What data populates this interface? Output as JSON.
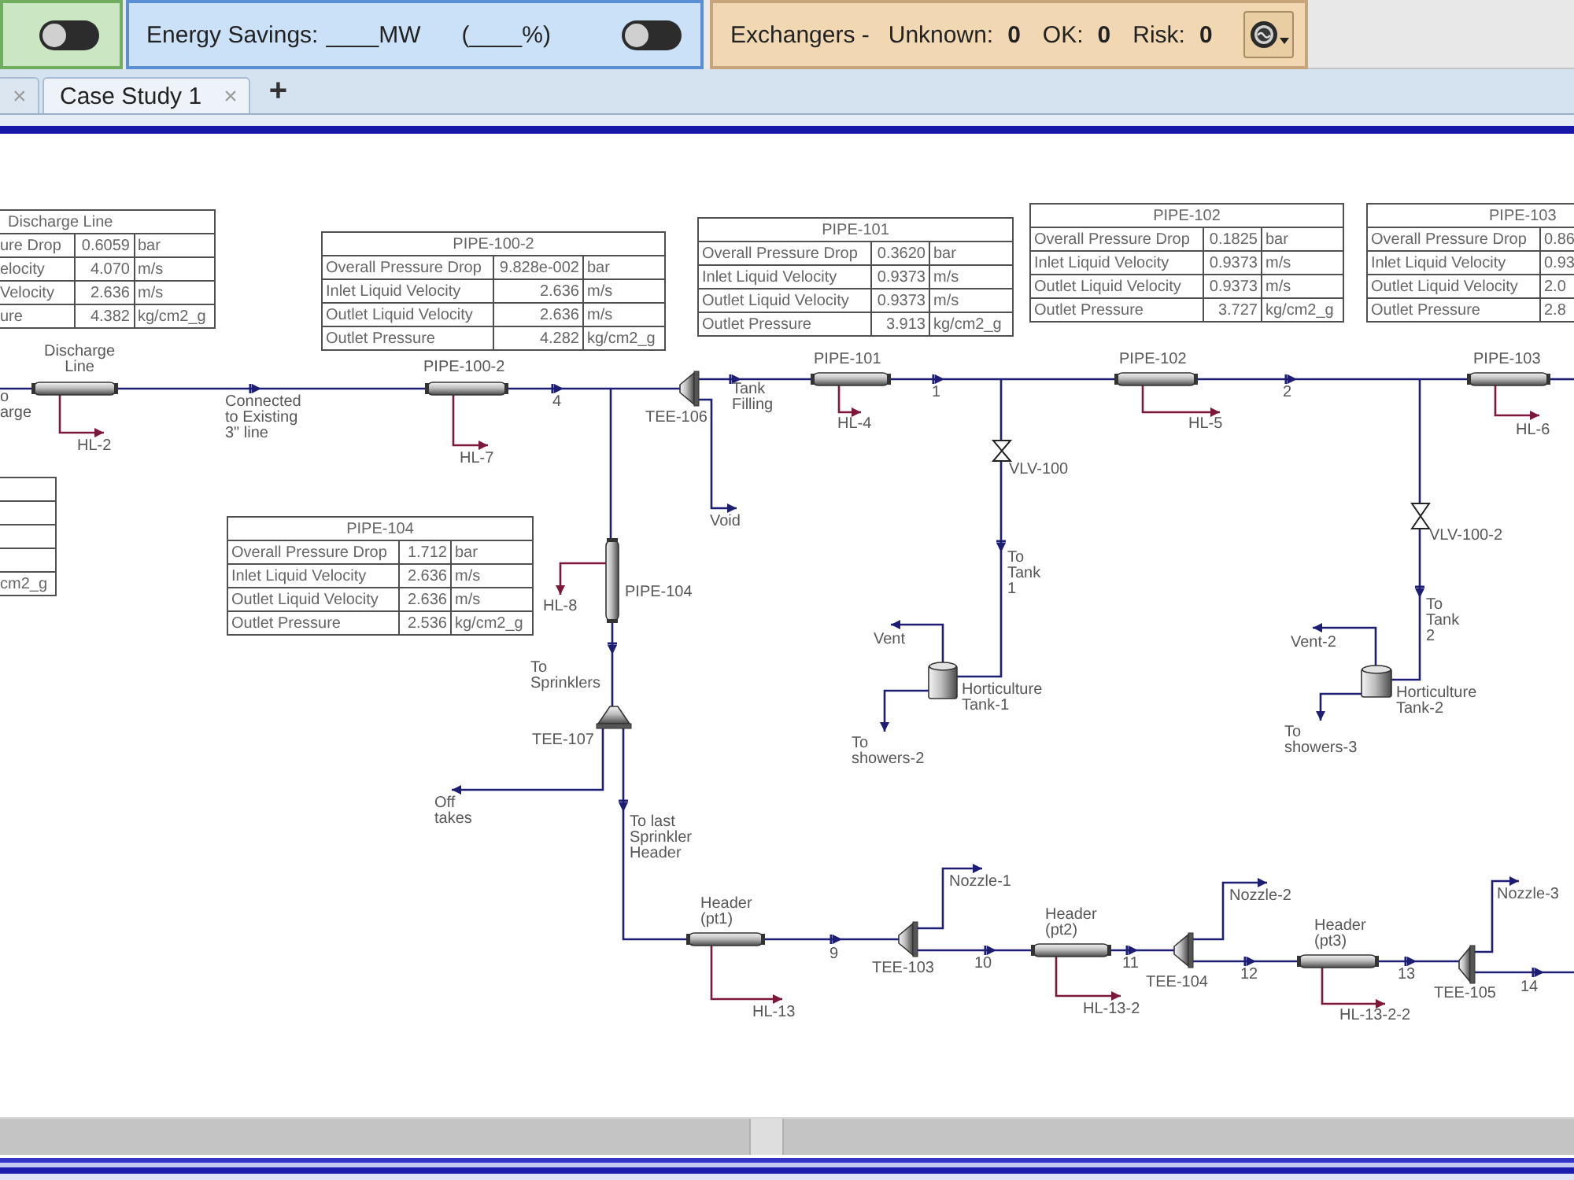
{
  "toolbar": {
    "utilities_toggle": {
      "on": false
    },
    "energy_savings": {
      "label": "Energy Savings:",
      "mw": "____MW",
      "percent": "(____%)",
      "toggle": {
        "on": false
      }
    },
    "exchangers": {
      "title": "Exchangers -",
      "counts": [
        {
          "label": "Unknown:",
          "value": "0"
        },
        {
          "label": "OK:",
          "value": "0"
        },
        {
          "label": "Risk:",
          "value": "0"
        }
      ]
    }
  },
  "tabs": [
    {
      "close": "×",
      "selected": false
    },
    {
      "label": "Case Study 1",
      "close": "×",
      "selected": true
    }
  ],
  "add_tab": "+",
  "flowsheet": {
    "tables": [
      {
        "title": "Discharge Line",
        "rows": [
          {
            "label": "ure Drop",
            "value": "0.6059",
            "unit": "bar"
          },
          {
            "label": "elocity",
            "value": "4.070",
            "unit": "m/s"
          },
          {
            "label": "Velocity",
            "value": "2.636",
            "unit": "m/s"
          },
          {
            "label": "ure",
            "value": "4.382",
            "unit": "kg/cm2_g"
          }
        ]
      },
      {
        "rows": [
          {},
          {},
          {},
          {
            "unit": "cm2_g"
          }
        ]
      },
      {
        "title": "PIPE-100-2",
        "rows": [
          {
            "label": "Overall Pressure Drop",
            "value": "9.828e-002",
            "unit": "bar"
          },
          {
            "label": "Inlet Liquid Velocity",
            "value": "2.636",
            "unit": "m/s"
          },
          {
            "label": "Outlet Liquid Velocity",
            "value": "2.636",
            "unit": "m/s"
          },
          {
            "label": "Outlet Pressure",
            "value": "4.282",
            "unit": "kg/cm2_g"
          }
        ]
      },
      {
        "title": "PIPE-101",
        "rows": [
          {
            "label": "Overall Pressure Drop",
            "value": "0.3620",
            "unit": "bar"
          },
          {
            "label": "Inlet Liquid Velocity",
            "value": "0.9373",
            "unit": "m/s"
          },
          {
            "label": "Outlet Liquid Velocity",
            "value": "0.9373",
            "unit": "m/s"
          },
          {
            "label": "Outlet Pressure",
            "value": "3.913",
            "unit": "kg/cm2_g"
          }
        ]
      },
      {
        "title": "PIPE-102",
        "rows": [
          {
            "label": "Overall Pressure Drop",
            "value": "0.1825",
            "unit": "bar"
          },
          {
            "label": "Inlet Liquid Velocity",
            "value": "0.9373",
            "unit": "m/s"
          },
          {
            "label": "Outlet Liquid Velocity",
            "value": "0.9373",
            "unit": "m/s"
          },
          {
            "label": "Outlet Pressure",
            "value": "3.727",
            "unit": "kg/cm2_g"
          }
        ]
      },
      {
        "title": "PIPE-103",
        "rows": [
          {
            "label": "Overall Pressure Drop",
            "value": "0.86"
          },
          {
            "label": "Inlet Liquid Velocity",
            "value": "0.93"
          },
          {
            "label": "Outlet Liquid Velocity",
            "value": "2.0"
          },
          {
            "label": "Outlet Pressure",
            "value": "2.8"
          }
        ]
      },
      {
        "title": "PIPE-104",
        "rows": [
          {
            "label": "Overall Pressure Drop",
            "value": "1.712",
            "unit": "bar"
          },
          {
            "label": "Inlet Liquid Velocity",
            "value": "2.636",
            "unit": "m/s"
          },
          {
            "label": "Outlet Liquid Velocity",
            "value": "2.636",
            "unit": "m/s"
          },
          {
            "label": "Outlet Pressure",
            "value": "2.536",
            "unit": "kg/cm2_g"
          }
        ]
      }
    ],
    "units": [
      {
        "kind": "pipe",
        "label": "Discharge\nLine"
      },
      {
        "kind": "pipe",
        "label": "PIPE-100-2"
      },
      {
        "kind": "tee",
        "label": "TEE-106"
      },
      {
        "kind": "pipe",
        "label": "PIPE-101"
      },
      {
        "kind": "pipe",
        "label": "PIPE-102"
      },
      {
        "kind": "pipe",
        "label": "PIPE-103"
      },
      {
        "kind": "pipe",
        "label": "PIPE-104"
      },
      {
        "kind": "valve",
        "label": "VLV-100"
      },
      {
        "kind": "valve",
        "label": "VLV-100-2"
      },
      {
        "kind": "tank",
        "label": "Horticulture\nTank-1"
      },
      {
        "kind": "tank",
        "label": "Horticulture\nTank-2"
      },
      {
        "kind": "tee",
        "label": "TEE-107"
      },
      {
        "kind": "pipe",
        "label": "Header\n(pt1)"
      },
      {
        "kind": "tee",
        "label": "TEE-103"
      },
      {
        "kind": "pipe",
        "label": "Header\n(pt2)"
      },
      {
        "kind": "tee",
        "label": "TEE-104"
      },
      {
        "kind": "pipe",
        "label": "Header\n(pt3)"
      },
      {
        "kind": "tee",
        "label": "TEE-105"
      }
    ],
    "stream_labels": [
      "o\narge",
      "HL-2",
      "Connected\nto Existing\n3\" line",
      "HL-7",
      "4",
      "Tank\nFilling",
      "Void",
      "HL-4",
      "1",
      "HL-5",
      "2",
      "HL-6",
      "HL-8",
      "To\nSprinklers",
      "To\nTank\n1",
      "Vent",
      "To\nshowers-2",
      "To\nTank\n2",
      "Vent-2",
      "To\nshowers-3",
      "Off\ntakes",
      "To last\nSprinkler\nHeader",
      "HL-13",
      "9",
      "Nozzle-1",
      "10",
      "HL-13-2",
      "11",
      "Nozzle-2",
      "12",
      "HL-13-2-2",
      "13",
      "Nozzle-3",
      "14"
    ]
  }
}
